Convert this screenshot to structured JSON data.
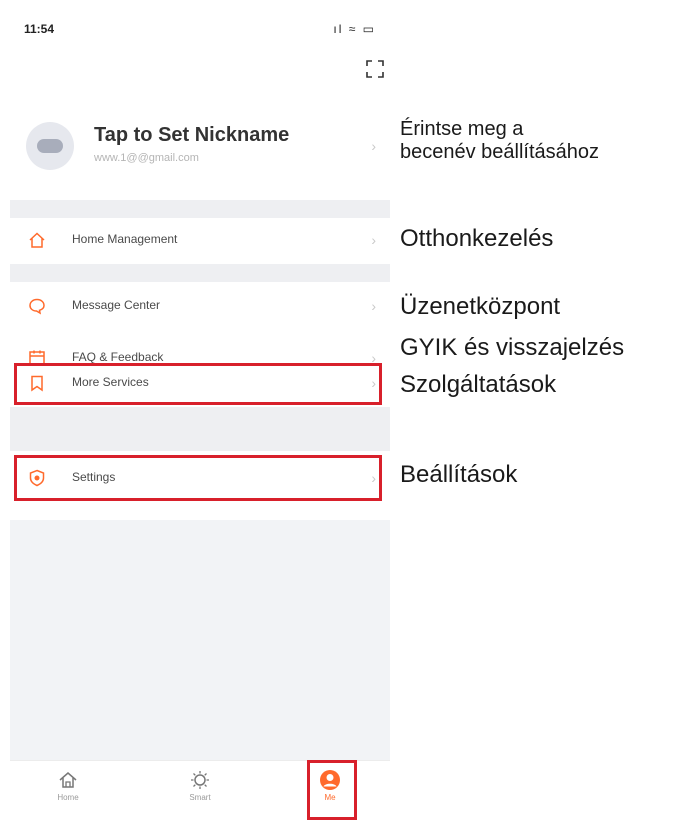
{
  "status_bar": {
    "time": "11:54",
    "icons": "ıl ≈ ▭"
  },
  "profile": {
    "nickname": "Tap to Set Nickname",
    "email": "www.1@@gmail.com"
  },
  "menu": {
    "home_management": "Home Management",
    "message_center": "Message Center",
    "faq_feedback": "FAQ & Feedback",
    "more_services": "More Services",
    "settings": "Settings"
  },
  "tabbar": {
    "home": "Home",
    "smart": "Smart",
    "me": "Me"
  },
  "annotations": {
    "nickname_line1": "Érintse meg a",
    "nickname_line2": "becenév beállításához",
    "home_management": "Otthonkezelés",
    "message_center": "Üzenetközpont",
    "faq_feedback": "GYIK és visszajelzés",
    "more_services": "Szolgáltatások",
    "settings": "Beállítások"
  },
  "colors": {
    "accent": "#ff6a2c",
    "highlight": "#d8202b"
  },
  "icons": [
    "expand-icon",
    "home-icon",
    "message-icon",
    "calendar-icon",
    "bookmark-icon",
    "shield-icon",
    "smart-icon",
    "person-icon"
  ]
}
